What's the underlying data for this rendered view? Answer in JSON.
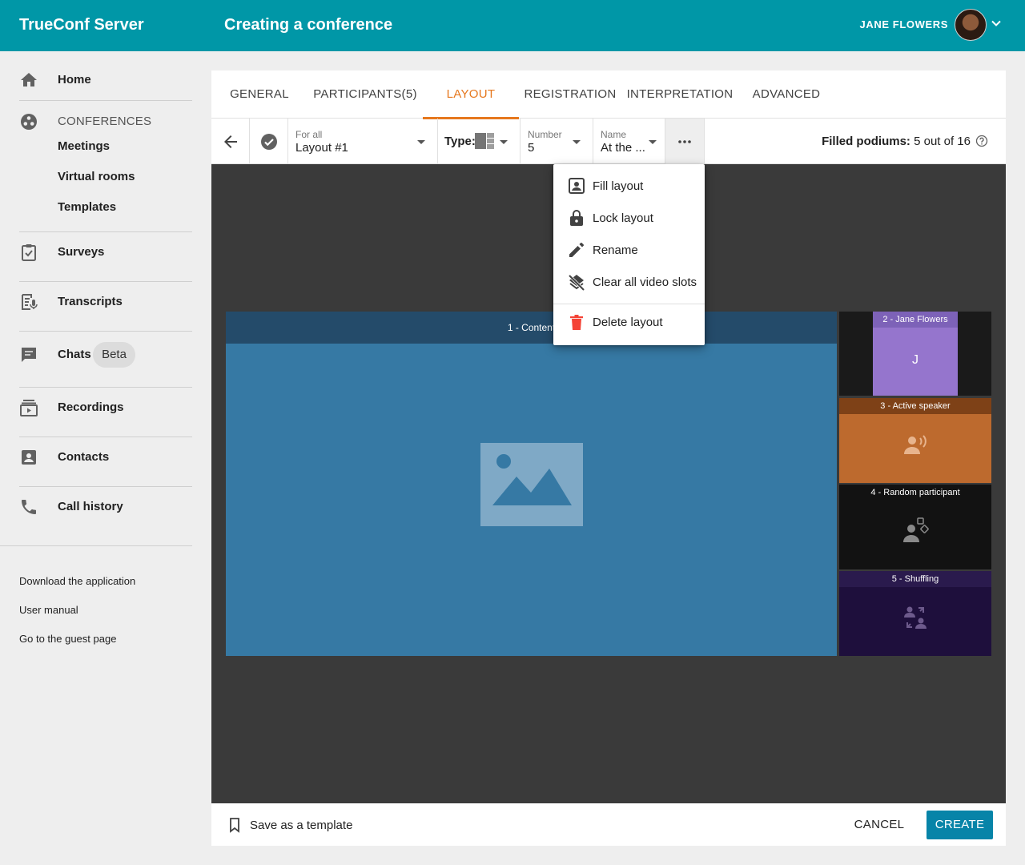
{
  "header": {
    "brand": "TrueConf Server",
    "page_title": "Creating a conference",
    "user_name": "JANE FLOWERS"
  },
  "sidebar": {
    "home": "Home",
    "conferences_section": "CONFERENCES",
    "meetings": "Meetings",
    "virtual_rooms": "Virtual rooms",
    "templates": "Templates",
    "surveys": "Surveys",
    "transcripts": "Transcripts",
    "chats": "Chats",
    "chats_badge": "Beta",
    "recordings": "Recordings",
    "contacts": "Contacts",
    "call_history": "Call history",
    "footer_links": [
      "Download the application",
      "User manual",
      "Go to the guest page"
    ]
  },
  "tabs": [
    {
      "label": "GENERAL"
    },
    {
      "label": "PARTICIPANTS(5)"
    },
    {
      "label": "LAYOUT"
    },
    {
      "label": "REGISTRATION"
    },
    {
      "label": "INTERPRETATION"
    },
    {
      "label": "ADVANCED"
    }
  ],
  "active_tab": "LAYOUT",
  "toolbar": {
    "for_label": "For all",
    "layout_value": "Layout #1",
    "type_label": "Type:",
    "number_label": "Number",
    "number_value": "5",
    "name_label": "Name",
    "name_value": "At the ...",
    "filled_label": "Filled podiums:",
    "filled_value": "5 out of 16"
  },
  "menu": {
    "items": [
      {
        "label": "Fill layout",
        "icon": "portrait-icon"
      },
      {
        "label": "Lock layout",
        "icon": "lock-icon"
      },
      {
        "label": "Rename",
        "icon": "pencil-icon"
      },
      {
        "label": "Clear all video slots",
        "icon": "layers-clear-icon"
      },
      {
        "label": "Delete layout",
        "icon": "trash-icon"
      }
    ]
  },
  "slots": [
    {
      "title": "1 - Content"
    },
    {
      "title": "2 - Jane Flowers",
      "initial": "J"
    },
    {
      "title": "3 - Active speaker"
    },
    {
      "title": "4 - Random participant"
    },
    {
      "title": "5 - Shuffling"
    }
  ],
  "footer": {
    "save_template": "Save as a template",
    "cancel": "CANCEL",
    "create": "CREATE"
  },
  "colors": {
    "header": "#0097a7",
    "accent": "#e6781e",
    "create_button": "#0784a8",
    "delete_icon": "#f44336"
  }
}
